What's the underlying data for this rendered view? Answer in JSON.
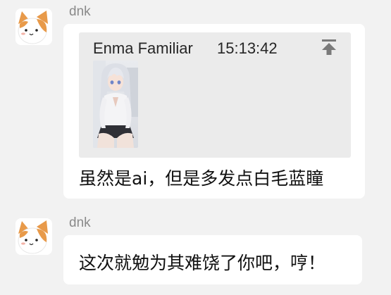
{
  "messages": [
    {
      "sender": "dnk",
      "avatar_icon": "cat-avatar-icon",
      "quote": {
        "author": "Enma Familiar",
        "time": "15:13:42",
        "jump_icon": "jump-to-top-icon",
        "image": "anime-girl-thumbnail"
      },
      "text": "虽然是ai，但是多发点白毛蓝瞳"
    },
    {
      "sender": "dnk",
      "avatar_icon": "cat-avatar-icon",
      "text": "这次就勉为其难饶了你吧，哼！"
    }
  ],
  "colors": {
    "background": "#f2f2f2",
    "bubble": "#ffffff",
    "quote_background": "#ebebeb",
    "sender_name": "#8a8a8a",
    "cat_orange": "#e89a4a"
  }
}
